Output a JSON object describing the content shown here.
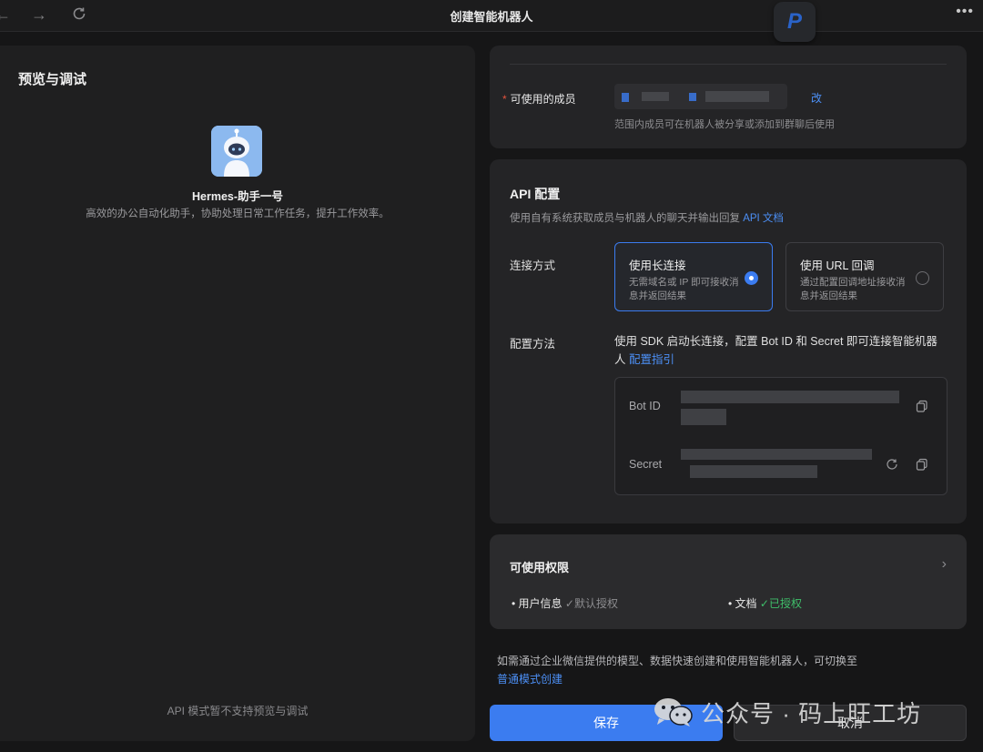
{
  "window": {
    "title": "创建智能机器人",
    "more_icon": "more-dots-icon"
  },
  "left": {
    "title": "预览与调试",
    "bot_name": "Hermes-助手一号",
    "bot_desc": "高效的办公自动化助手，协助处理日常工作任务，提升工作效率。",
    "footer": "API 模式暂不支持预览与调试"
  },
  "members": {
    "label": "可使用的成员",
    "edit_label": "改",
    "hint": "范围内成员可在机器人被分享或添加到群聊后使用"
  },
  "api": {
    "title": "API 配置",
    "desc": "使用自有系统获取成员与机器人的聊天并输出回复",
    "doc_link": "API 文档",
    "conn_label": "连接方式",
    "options": [
      {
        "title": "使用长连接",
        "sub": "无需域名或 IP 即可接收消息并返回结果",
        "selected": true
      },
      {
        "title": "使用 URL 回调",
        "sub": "通过配置回调地址接收消息并返回结果",
        "selected": false
      }
    ],
    "method_label": "配置方法",
    "method_text": "使用 SDK 启动长连接，配置 Bot ID 和 Secret 即可连接智能机器人",
    "guide_link": "配置指引",
    "bot_id_label": "Bot ID",
    "secret_label": "Secret"
  },
  "permissions": {
    "title": "可使用权限",
    "items": [
      {
        "name": "用户信息",
        "status": "默认授权"
      },
      {
        "name": "文档",
        "status": "已授权"
      }
    ]
  },
  "switch_mode": {
    "text": "如需通过企业微信提供的模型、数据快速创建和使用智能机器人，可切换至",
    "link": "普通模式创建"
  },
  "buttons": {
    "save": "保存",
    "cancel": "取消"
  },
  "watermark": {
    "text": "公众号 · 码上旺工坊"
  },
  "colors": {
    "accent": "#3b7cf0",
    "success": "#3fbf6a",
    "required": "#e5533d"
  }
}
